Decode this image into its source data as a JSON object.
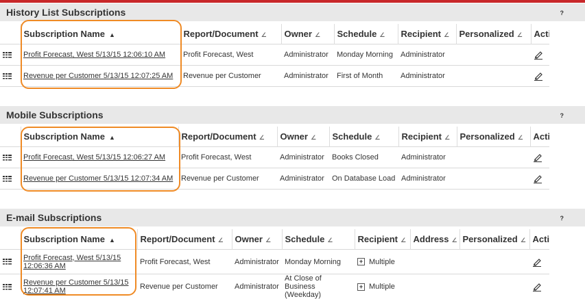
{
  "history": {
    "title": "History List Subscriptions",
    "help": "?",
    "columns": [
      "Subscription Name",
      "Report/Document",
      "Owner",
      "Schedule",
      "Recipient",
      "Personalized",
      "Action"
    ],
    "rows": [
      {
        "name": "Profit Forecast, West 5/13/15 12:06:10 AM",
        "report": "Profit Forecast, West",
        "owner": "Administrator",
        "schedule": "Monday Morning",
        "recipient": "Administrator"
      },
      {
        "name": "Revenue per Customer 5/13/15 12:07:25 AM",
        "report": "Revenue per Customer",
        "owner": "Administrator",
        "schedule": "First of Month",
        "recipient": "Administrator"
      }
    ]
  },
  "mobile": {
    "title": "Mobile Subscriptions",
    "help": "?",
    "columns": [
      "Subscription Name",
      "Report/Document",
      "Owner",
      "Schedule",
      "Recipient",
      "Personalized",
      "Action"
    ],
    "rows": [
      {
        "name": "Profit Forecast, West 5/13/15 12:06:27 AM",
        "report": "Profit Forecast, West",
        "owner": "Administrator",
        "schedule": "Books Closed",
        "recipient": "Administrator"
      },
      {
        "name": "Revenue per Customer 5/13/15 12:07:34 AM",
        "report": "Revenue per Customer",
        "owner": "Administrator",
        "schedule": "On Database Load",
        "recipient": "Administrator"
      }
    ]
  },
  "email": {
    "title": "E-mail Subscriptions",
    "help": "?",
    "columns": [
      "Subscription Name",
      "Report/Document",
      "Owner",
      "Schedule",
      "Recipient",
      "Address",
      "Personalized",
      "Action"
    ],
    "rows": [
      {
        "name": "Profit Forecast, West 5/13/15 12:06:36 AM",
        "report": "Profit Forecast, West",
        "owner": "Administrator",
        "schedule": "Monday Morning",
        "recipient": "Multiple"
      },
      {
        "name": "Revenue per Customer 5/13/15 12:07:41 AM",
        "report": "Revenue per Customer",
        "owner": "Administrator",
        "schedule": "At Close of Business (Weekday)",
        "recipient": "Multiple"
      }
    ]
  },
  "sort_indicator": "▲",
  "column_menu_glyph": "∠",
  "colors": {
    "accent_bar": "#c8282a",
    "highlight": "#ef8a24",
    "header_bg": "#e8e8e8"
  }
}
